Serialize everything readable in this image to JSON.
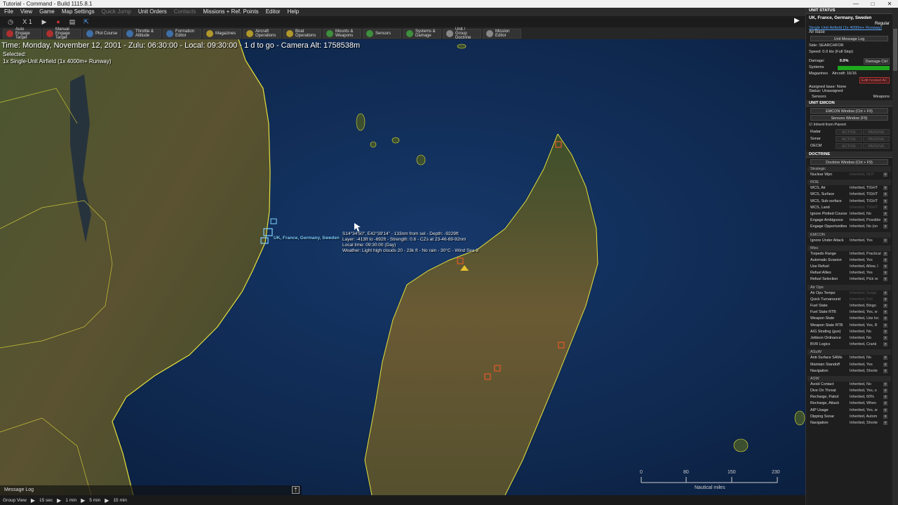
{
  "window": {
    "title": "Tutorial - Command - Build 1115.8.1"
  },
  "menu": [
    "File",
    "View",
    "Game",
    "Map Settings",
    "Quick Jump",
    "Unit Orders",
    "Contacts",
    "Missions + Ref. Points",
    "Editor",
    "Help"
  ],
  "menu_disabled": [
    "Quick Jump",
    "Contacts"
  ],
  "speed": {
    "multiplier": "X 1"
  },
  "toolbar": [
    {
      "label": "Auto Engage Target",
      "color": "red"
    },
    {
      "label": "Manual Engage Target",
      "color": "red"
    },
    {
      "label": "Plot Course",
      "color": "blue"
    },
    {
      "label": "Throttle & Altitude",
      "color": "blue"
    },
    {
      "label": "Formation Editor",
      "color": "blue"
    },
    {
      "label": "Magazines",
      "color": "yellow"
    },
    {
      "label": "Aircraft Operations",
      "color": "yellow"
    },
    {
      "label": "Boat Operations",
      "color": "yellow"
    },
    {
      "label": "Mounts & Weapons",
      "color": "green"
    },
    {
      "label": "Sensors",
      "color": "green"
    },
    {
      "label": "Systems & Damage",
      "color": "green"
    },
    {
      "label": "Unit / Group Doctrine",
      "color": "gray"
    },
    {
      "label": "Mission Editor",
      "color": "gray"
    }
  ],
  "map": {
    "status_line": "Time: Monday, November 12, 2001 - Zulu: 06:30:00 - Local: 09:30:00 - 1 d to go  -  Camera Alt: 1758538m",
    "selected_label": "Selected:",
    "selected_unit": "1x Single-Unit Airfield (1x 4000m+ Runway)",
    "hover_lines": [
      "S14°34'50\", E42°39'14\" - 133nm from sel - Depth: -9229ft",
      "Layer: -413ft to -692ft - Strength: 0.6 - CZs at 23-46-69-92nm",
      "Local time: 09:30:00 (Day)",
      "Weather: Light high clouds 20 - 23k ft - No rain - 30°C - Wind Sea 3"
    ],
    "unit_label": "UK, France, Germany, Sweden",
    "scale": {
      "ticks": [
        "0",
        "80",
        "150",
        "230"
      ],
      "unit": "Nautical miles"
    }
  },
  "message_log": {
    "label": "Message Log"
  },
  "bottombar": {
    "group_view": "Group View",
    "steps": [
      "15 sec",
      "1 min",
      "5 min",
      "15 min"
    ]
  },
  "panel": {
    "unit_status_title": "UNIT STATUS",
    "side_name": "UK, France, Germany, Sweden",
    "proficiency": "Regular",
    "unit_name": "Single Unit Airfield (1x 4000m+ Runway)",
    "unit_type": "Air Base",
    "unit_message_log": "Unit Message Log",
    "side_line": "Side: SEARCHFOR",
    "speed_line": "Speed: 0.0 kts (Full Stop)",
    "damage_label": "Damage:",
    "damage_value": "0.0%",
    "damage_ctrl": "Damage Ctrl",
    "systems_label": "Systems",
    "magazines_label": "Magazines",
    "aircraft_value": "Aircraft: 16/16",
    "edit_hosted": "Edit hosted AC",
    "assigned_base": "Assigned base: None",
    "status": "Status: Unassigned",
    "sensors_btn": "Sensors",
    "weapons_btn": "Weapons",
    "emcon_title": "UNIT EMCON",
    "emcon_window": "EMCON Window (Ctrl + F9)",
    "sensors_window": "Sensors Window (F9)",
    "inherit_parent": "Inherit from Parent",
    "emcon_rows": [
      {
        "name": "Radar",
        "a": "ACTIVE",
        "p": "PASSIVE"
      },
      {
        "name": "Sonar",
        "a": "ACTIVE",
        "p": "PASSIVE"
      },
      {
        "name": "OECM",
        "a": "ACTIVE",
        "p": "PASSIVE"
      }
    ],
    "doctrine_title": "DOCTRINE",
    "doctrine_window": "Doctrine Window (Ctrl + F9)",
    "doctrine_groups": [
      {
        "name": "Strategic",
        "rows": [
          {
            "k": "Nuclear Wpn",
            "v": "Inherited, NOT",
            "dis": true
          }
        ]
      },
      {
        "name": "ROE",
        "rows": [
          {
            "k": "WCS, Air",
            "v": "Inherited, TIGHT"
          },
          {
            "k": "WCS, Surface",
            "v": "Inherited, TIGHT"
          },
          {
            "k": "WCS, Sub-surface",
            "v": "Inherited, TIGHT"
          },
          {
            "k": "WCS, Land",
            "v": "Inherited, TIGHT",
            "dis": true
          },
          {
            "k": "Ignore Plotted Course",
            "v": "Inherited, No"
          },
          {
            "k": "Engage Ambiguous",
            "v": "Inherited, Possible"
          },
          {
            "k": "Engage Opportunities",
            "v": "Inherited, No (on"
          }
        ]
      },
      {
        "name": "EMCON",
        "rows": [
          {
            "k": "Ignore Under Attack",
            "v": "Inherited, Yes"
          }
        ]
      },
      {
        "name": "Misc",
        "rows": [
          {
            "k": "Torpedo Range",
            "v": "Inherited, Practical"
          },
          {
            "k": "Automatic Evasion",
            "v": "Inherited, Yes"
          },
          {
            "k": "Use Refuel",
            "v": "Inherited, Allow, I"
          },
          {
            "k": "Refuel Allies",
            "v": "Inherited, Yes"
          },
          {
            "k": "Refuel Selection",
            "v": "Inherited, Pick re"
          }
        ]
      },
      {
        "name": "Air Ops",
        "rows": [
          {
            "k": "Air Ops Tempo",
            "v": "Inherited, Surge",
            "dis": true
          },
          {
            "k": "Quick Turnaround",
            "v": "Inherited, Full",
            "dis": true
          },
          {
            "k": "Fuel State",
            "v": "Inherited, Bingo"
          },
          {
            "k": "Fuel State RTB",
            "v": "Inherited, Yes, w"
          },
          {
            "k": "Weapon State",
            "v": "Inherited, Use loc"
          },
          {
            "k": "Weapon State RTB",
            "v": "Inherited, Yes, R"
          },
          {
            "k": "A/G Strafing (gun)",
            "v": "Inherited, No"
          },
          {
            "k": "Jettison Ordnance",
            "v": "Inherited, No"
          },
          {
            "k": "BVR Logics",
            "v": "Inherited, Crank"
          }
        ]
      },
      {
        "name": "ASuW",
        "rows": [
          {
            "k": "Anti-Surface SAMs",
            "v": "Inherited, No"
          },
          {
            "k": "Maintain Standoff",
            "v": "Inherited, Yes"
          },
          {
            "k": "Navigation",
            "v": "Inherited, Shorte"
          }
        ]
      },
      {
        "name": "ASW",
        "rows": [
          {
            "k": "Avoid Contact",
            "v": "Inherited, No"
          },
          {
            "k": "Dive On Threat",
            "v": "Inherited, Yes, o"
          },
          {
            "k": "Recharge, Patrol",
            "v": "Inherited, 60%"
          },
          {
            "k": "Recharge, Attack",
            "v": "Inherited, When"
          },
          {
            "k": "AIP Usage",
            "v": "Inherited, Yes, w"
          },
          {
            "k": "Dipping Sonar",
            "v": "Inherited, Autom"
          },
          {
            "k": "Navigation",
            "v": "Inherited, Shorte"
          }
        ]
      }
    ]
  }
}
